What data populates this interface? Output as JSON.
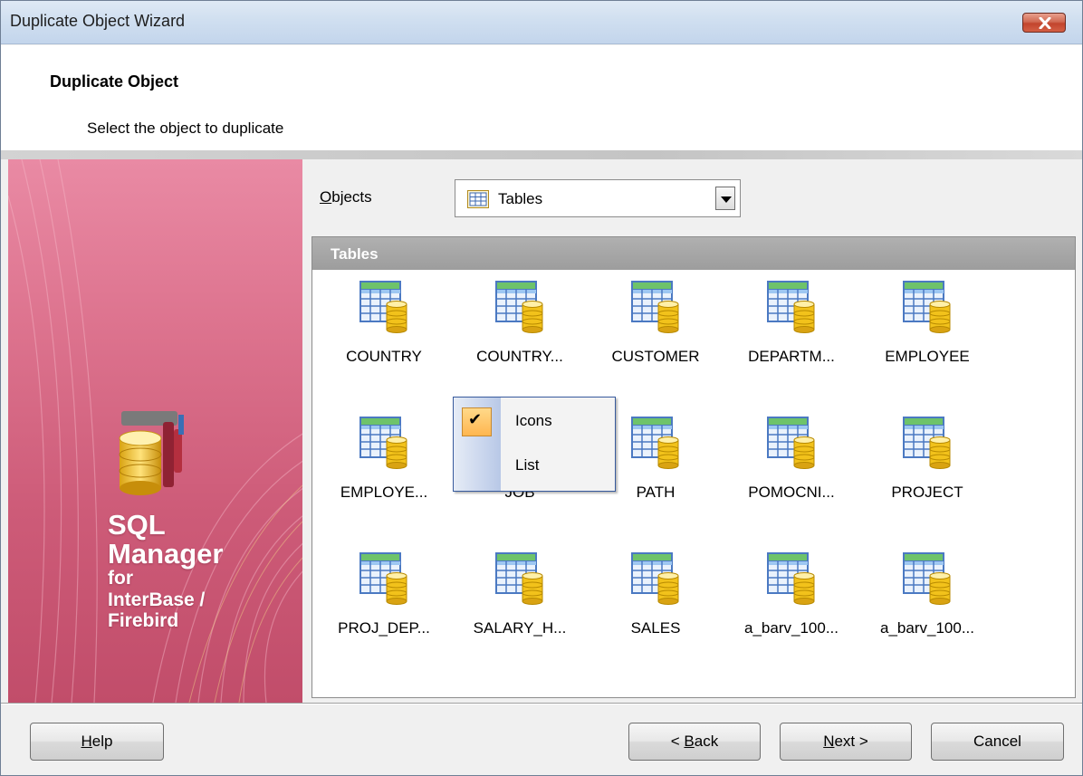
{
  "window": {
    "title": "Duplicate Object Wizard"
  },
  "header": {
    "title": "Duplicate Object",
    "subtitle": "Select the object to duplicate"
  },
  "banner": {
    "line1": "SQL",
    "line2": "Manager",
    "line3": "for",
    "line4": "InterBase /",
    "line5": "Firebird"
  },
  "objects": {
    "label_u": "O",
    "label_rest": "bjects",
    "selected": "Tables",
    "icon": "table-icon"
  },
  "panel": {
    "title": "Tables"
  },
  "items": [
    "COUNTRY",
    "COUNTRY...",
    "CUSTOMER",
    "DEPARTM...",
    "EMPLOYEE",
    "EMPLOYE...",
    "JOB",
    "PATH",
    "POMOCNI...",
    "PROJECT",
    "PROJ_DEP...",
    "SALARY_H...",
    "SALES",
    "a_barv_100...",
    "a_barv_100..."
  ],
  "context_menu": {
    "items": [
      {
        "label": "Icons",
        "checked": true
      },
      {
        "label": "List",
        "checked": false
      }
    ]
  },
  "buttons": {
    "help_u": "H",
    "help_rest": "elp",
    "back_pre": "< ",
    "back_u": "B",
    "back_rest": "ack",
    "next_u": "N",
    "next_rest": "ext >",
    "cancel": "Cancel"
  },
  "colors": {
    "banner": "#d8688a",
    "list_header": "#a6a6a6",
    "menu_check": "#ffc66b"
  }
}
